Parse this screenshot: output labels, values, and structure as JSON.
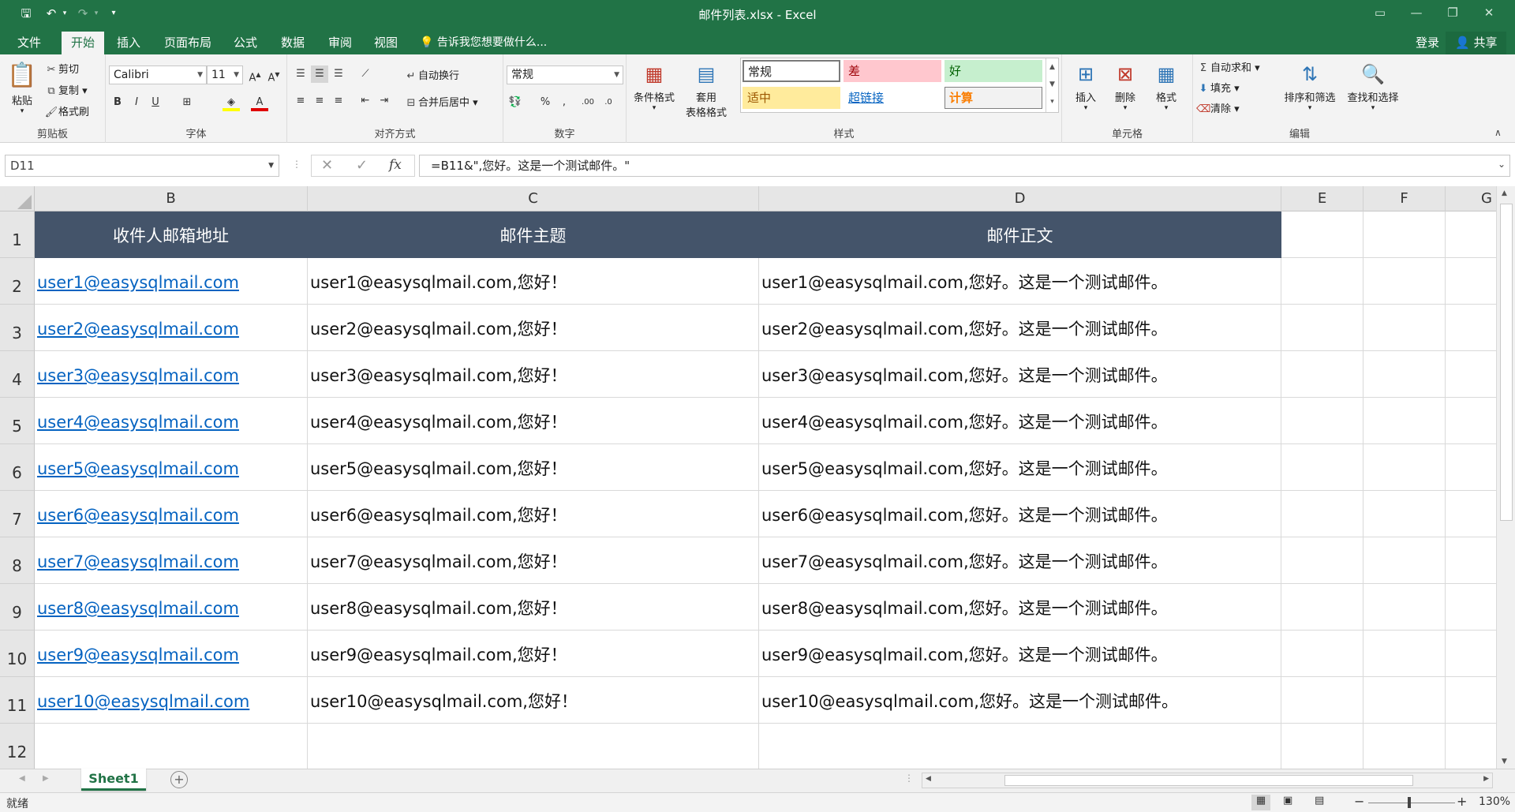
{
  "titlebar": {
    "title": "邮件列表.xlsx - Excel",
    "qa_save": "🖫",
    "qa_undo": "↶",
    "qa_redo": "↷",
    "qa_more": "▾"
  },
  "menu": {
    "tabs": [
      "文件",
      "开始",
      "插入",
      "页面布局",
      "公式",
      "数据",
      "审阅",
      "视图"
    ],
    "tell_me": "告诉我您想要做什么...",
    "login": "登录",
    "share": "共享"
  },
  "ribbon": {
    "clipboard": {
      "paste": "粘贴",
      "cut": "剪切",
      "copy": "复制",
      "format_painter": "格式刷",
      "label": "剪贴板"
    },
    "font": {
      "name": "Calibri",
      "size": "11",
      "bold": "B",
      "italic": "I",
      "underline": "U",
      "label": "字体"
    },
    "alignment": {
      "wrap": "自动换行",
      "merge": "合并后居中",
      "label": "对齐方式"
    },
    "number": {
      "format": "常规",
      "percent": "%",
      "comma": ",",
      "label": "数字"
    },
    "styles": {
      "conditional": "条件格式",
      "table_format_1": "套用",
      "table_format_2": "表格格式",
      "normal": "常规",
      "bad": "差",
      "good": "好",
      "neutral": "适中",
      "hyperlink": "超链接",
      "calc": "计算",
      "label": "样式"
    },
    "cells": {
      "insert": "插入",
      "delete": "删除",
      "format": "格式",
      "label": "单元格"
    },
    "editing": {
      "autosum": "自动求和",
      "fill": "填充",
      "clear": "清除",
      "sort": "排序和筛选",
      "find": "查找和选择",
      "label": "编辑"
    }
  },
  "formula_bar": {
    "name_box": "D11",
    "cancel": "✕",
    "enter": "✓",
    "fx": "fx",
    "formula": "=B11&\",您好。这是一个测试邮件。\""
  },
  "sheet": {
    "columns": [
      "B",
      "C",
      "D",
      "E",
      "F",
      "G"
    ],
    "row_numbers": [
      "1",
      "2",
      "3",
      "4",
      "5",
      "6",
      "7",
      "8",
      "9",
      "10",
      "11",
      "12"
    ],
    "header": [
      "收件人邮箱地址",
      "邮件主题",
      "邮件正文"
    ],
    "rows": [
      [
        "user1@easysqlmail.com",
        "user1@easysqlmail.com,您好！",
        "user1@easysqlmail.com,您好。这是一个测试邮件。"
      ],
      [
        "user2@easysqlmail.com",
        "user2@easysqlmail.com,您好！",
        "user2@easysqlmail.com,您好。这是一个测试邮件。"
      ],
      [
        "user3@easysqlmail.com",
        "user3@easysqlmail.com,您好！",
        "user3@easysqlmail.com,您好。这是一个测试邮件。"
      ],
      [
        "user4@easysqlmail.com",
        "user4@easysqlmail.com,您好！",
        "user4@easysqlmail.com,您好。这是一个测试邮件。"
      ],
      [
        "user5@easysqlmail.com",
        "user5@easysqlmail.com,您好！",
        "user5@easysqlmail.com,您好。这是一个测试邮件。"
      ],
      [
        "user6@easysqlmail.com",
        "user6@easysqlmail.com,您好！",
        "user6@easysqlmail.com,您好。这是一个测试邮件。"
      ],
      [
        "user7@easysqlmail.com",
        "user7@easysqlmail.com,您好！",
        "user7@easysqlmail.com,您好。这是一个测试邮件。"
      ],
      [
        "user8@easysqlmail.com",
        "user8@easysqlmail.com,您好！",
        "user8@easysqlmail.com,您好。这是一个测试邮件。"
      ],
      [
        "user9@easysqlmail.com",
        "user9@easysqlmail.com,您好！",
        "user9@easysqlmail.com,您好。这是一个测试邮件。"
      ],
      [
        "user10@easysqlmail.com",
        "user10@easysqlmail.com,您好！",
        "user10@easysqlmail.com,您好。这是一个测试邮件。"
      ]
    ],
    "tab_name": "Sheet1",
    "add_sheet": "+"
  },
  "status": {
    "ready": "就绪",
    "zoom_minus": "−",
    "zoom_plus": "+",
    "zoom": "130%"
  },
  "colors": {
    "accent": "#217346",
    "header_fill": "#44546a",
    "link": "#0563c1"
  }
}
